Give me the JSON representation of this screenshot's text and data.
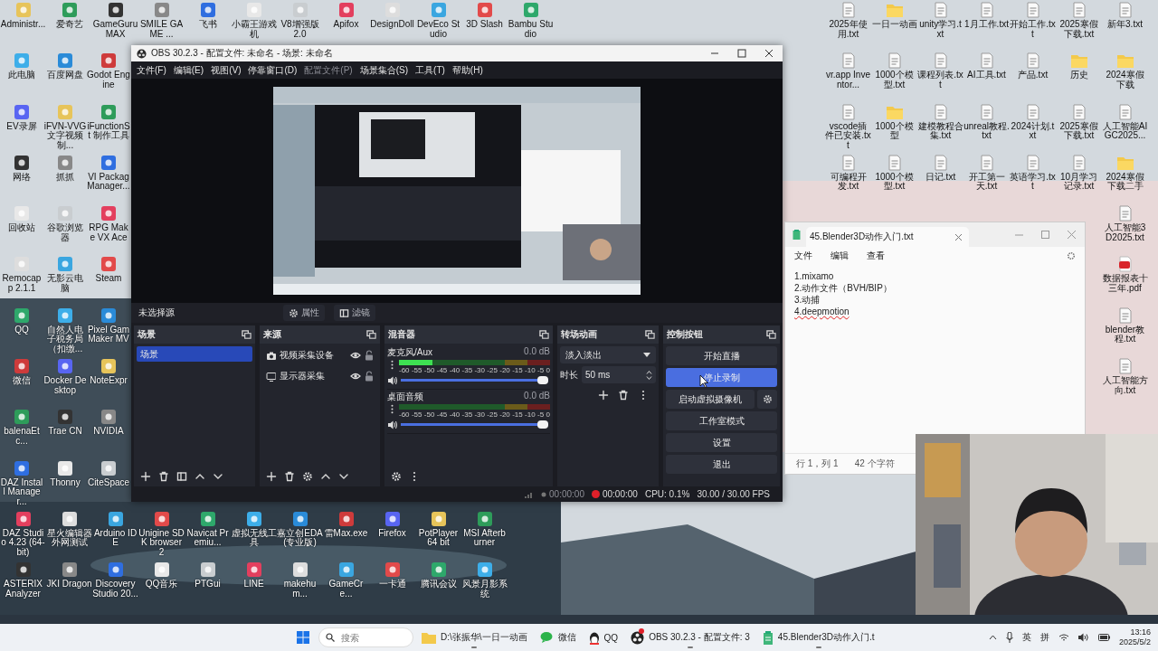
{
  "desktop": {
    "left_rows": [
      [
        {
          "label": "Administr..."
        },
        {
          "label": "爱奇艺"
        },
        {
          "label": "GameGuru MAX"
        },
        {
          "label": "SMILE GAME ..."
        },
        {
          "label": "飞书"
        },
        {
          "label": "小霸王游戏机"
        },
        {
          "label": "V8增强版 2.0"
        },
        {
          "label": "Apifox"
        },
        {
          "label": "DesignDoll"
        },
        {
          "label": "DevEco Studio"
        },
        {
          "label": "3D Slash"
        },
        {
          "label": "Bambu Studio"
        }
      ],
      [
        {
          "label": "此电脑"
        },
        {
          "label": "百度网盘"
        },
        {
          "label": "Godot Engine"
        }
      ],
      [
        {
          "label": "EV录屏"
        },
        {
          "label": "iFVN-VVG文字视频制..."
        },
        {
          "label": "iFunctionSt 制作工具"
        }
      ],
      [
        {
          "label": "网络"
        },
        {
          "label": "抓抓"
        },
        {
          "label": "VI Packag Manager..."
        }
      ],
      [
        {
          "label": "回收站"
        },
        {
          "label": "谷歌浏览器"
        },
        {
          "label": "RPG Make VX Ace"
        }
      ],
      [
        {
          "label": "Remocapp 2.1.1"
        },
        {
          "label": "无影云电脑"
        },
        {
          "label": "Steam"
        }
      ],
      [
        {
          "label": "QQ"
        },
        {
          "label": "自然人电子税务局（扣缴..."
        },
        {
          "label": "Pixel Gam Maker MV"
        }
      ],
      [
        {
          "label": "微信"
        },
        {
          "label": "Docker Desktop"
        },
        {
          "label": "NoteExpr"
        }
      ],
      [
        {
          "label": "balenaEtc..."
        },
        {
          "label": "Trae CN"
        },
        {
          "label": "NVIDIA"
        }
      ],
      [
        {
          "label": "DAZ Install Manager..."
        },
        {
          "label": "Thonny"
        },
        {
          "label": "CiteSpace"
        }
      ],
      [
        {
          "label": "DAZ Studio 4.23 (64-bit)"
        },
        {
          "label": "星火编辑器外网测试"
        },
        {
          "label": "Arduino IDE"
        },
        {
          "label": "Unigine SDK browser 2"
        },
        {
          "label": "Navicat Premiu..."
        },
        {
          "label": "虚拟无线工具"
        },
        {
          "label": "嘉立创EDA(专业版)"
        },
        {
          "label": "雷Max.exe"
        },
        {
          "label": "Firefox"
        },
        {
          "label": "PotPlayer 64 bit"
        },
        {
          "label": "MSI Afterburner"
        }
      ],
      [
        {
          "label": "ASTERIX Analyzer"
        },
        {
          "label": "JKI Dragon"
        },
        {
          "label": "Discovery Studio 20..."
        },
        {
          "label": "QQ音乐"
        },
        {
          "label": "PTGui"
        },
        {
          "label": "LINE"
        },
        {
          "label": "makehum..."
        },
        {
          "label": "GameCre..."
        },
        {
          "label": "一卡通"
        },
        {
          "label": "腾讯会议"
        },
        {
          "label": "风景月影系统"
        }
      ]
    ],
    "right_rows": [
      [
        {
          "kind": "file",
          "label": "2025年使用.txt"
        },
        {
          "kind": "folder",
          "label": "一日一动画"
        },
        {
          "kind": "file",
          "label": "unity学习.txt"
        },
        {
          "kind": "file",
          "label": "1月工作.txt"
        },
        {
          "kind": "file",
          "label": "开始工作.txt"
        },
        {
          "kind": "file",
          "label": "2025寒假下载.txt"
        },
        {
          "kind": "file",
          "label": "新年3.txt"
        }
      ],
      [
        {
          "kind": "file",
          "label": "vr.app Inventor..."
        },
        {
          "kind": "file",
          "label": "1000个模型.txt"
        },
        {
          "kind": "file",
          "label": "课程列表.txt"
        },
        {
          "kind": "file",
          "label": "AI工具.txt"
        },
        {
          "kind": "file",
          "label": "产品.txt"
        },
        {
          "kind": "folder",
          "label": "历史"
        },
        {
          "kind": "folder",
          "label": "2024寒假下载"
        }
      ],
      [
        {
          "kind": "file",
          "label": "vscode插件已安装.txt"
        },
        {
          "kind": "folder",
          "label": "1000个模型"
        },
        {
          "kind": "file",
          "label": "建模教程合集.txt"
        },
        {
          "kind": "file",
          "label": "unreal教程.txt"
        },
        {
          "kind": "file",
          "label": "2024计划.txt"
        },
        {
          "kind": "file",
          "label": "2025寒假下载.txt"
        },
        {
          "kind": "file",
          "label": "人工智能AIGC2025..."
        }
      ],
      [
        {
          "kind": "file",
          "label": "可编程开发.txt"
        },
        {
          "kind": "file",
          "label": "1000个模型.txt"
        },
        {
          "kind": "file",
          "label": "日记.txt"
        },
        {
          "kind": "file",
          "label": "开工第一天.txt"
        },
        {
          "kind": "file",
          "label": "英语学习.txt"
        },
        {
          "kind": "file",
          "label": "10月学习记录.txt"
        },
        {
          "kind": "folder",
          "label": "2024寒假下载二手"
        }
      ],
      [
        {
          "kind": "file",
          "label": "人工智能3D2025.txt"
        }
      ],
      [
        {
          "kind": "pdf",
          "label": "数据报表十三年.pdf"
        }
      ],
      [
        {
          "kind": "file",
          "label": "blender教程.txt"
        }
      ],
      [
        {
          "kind": "file",
          "label": "人工智能方向.txt"
        }
      ]
    ]
  },
  "obs": {
    "title": "OBS 30.2.3 - 配置文件: 未命名 - 场景: 未命名",
    "menu": [
      {
        "label": "文件(F)",
        "disabled": false
      },
      {
        "label": "编辑(E)",
        "disabled": false
      },
      {
        "label": "视图(V)",
        "disabled": false
      },
      {
        "label": "停靠窗口(D)",
        "disabled": false
      },
      {
        "label": "配置文件(P)",
        "disabled": true
      },
      {
        "label": "场景集合(S)",
        "disabled": false
      },
      {
        "label": "工具(T)",
        "disabled": false
      },
      {
        "label": "帮助(H)",
        "disabled": false
      }
    ],
    "source_toolbar": {
      "label": "未选择源",
      "properties": "属性",
      "filters": "滤镜"
    },
    "scenes": {
      "title": "场景",
      "items": [
        {
          "label": "场景",
          "selected": true
        }
      ]
    },
    "sources": {
      "title": "来源",
      "items": [
        {
          "kind": "camera",
          "label": "视频采集设备",
          "visible": true,
          "locked": false
        },
        {
          "kind": "display",
          "label": "显示器采集",
          "visible": true,
          "locked": false
        }
      ]
    },
    "mixer": {
      "title": "混音器",
      "channels": [
        {
          "name": "麦克风/Aux",
          "reading": "0.0 dB",
          "meter": {
            "level": 0.22
          },
          "fader": {
            "level": 1
          },
          "scale": [
            "-60",
            "-55",
            "-50",
            "-45",
            "-40",
            "-35",
            "-30",
            "-25",
            "-20",
            "-15",
            "-10",
            "-5",
            "0"
          ]
        },
        {
          "name": "桌面音频",
          "reading": "0.0 dB",
          "fader": {
            "level": 1
          },
          "scale": [
            "-60",
            "-55",
            "-50",
            "-45",
            "-40",
            "-35",
            "-30",
            "-25",
            "-20",
            "-15",
            "-10",
            "-5",
            "0"
          ]
        }
      ]
    },
    "transitions": {
      "title": "转场动画",
      "transition": "淡入淡出",
      "duration_label": "时长",
      "duration": "50 ms"
    },
    "controls": {
      "title": "控制按钮",
      "buttons": [
        {
          "kind": "plain",
          "label": "开始直播",
          "highlighted": false
        },
        {
          "kind": "plain",
          "label": "停止录制",
          "highlighted": true
        },
        {
          "kind": "with_settings",
          "label": "启动虚拟摄像机",
          "highlighted": false
        },
        {
          "kind": "plain",
          "label": "工作室模式",
          "highlighted": false
        },
        {
          "kind": "plain",
          "label": "设置",
          "highlighted": false
        },
        {
          "kind": "plain",
          "label": "退出",
          "highlighted": false
        }
      ]
    },
    "status": {
      "stream_time": "00:00:00",
      "record_time": "00:00:00",
      "cpu": "CPU: 0.1%",
      "fps": "30.00 / 30.00 FPS"
    }
  },
  "notepad": {
    "tab_title": "45.Blender3D动作入门.txt",
    "menu": [
      "文件",
      "编辑",
      "查看"
    ],
    "lines": [
      {
        "text": "1.mixamo",
        "misspelled": false
      },
      {
        "text": "2.动作文件（BVH/BIP）",
        "misspelled": false
      },
      {
        "text": "3.动捕",
        "misspelled": false
      },
      {
        "text": "4.deepmotion",
        "misspelled": true
      }
    ],
    "status": [
      "行 1，列 1",
      "42 个字符"
    ]
  },
  "taskbar": {
    "search_placeholder": "搜索",
    "apps": [
      {
        "kind": "folder",
        "label": "D:\\张振华\\一日一动画",
        "running": true,
        "recording": false
      },
      {
        "kind": "wechat",
        "label": "微信",
        "running": false,
        "recording": false
      },
      {
        "kind": "qq",
        "label": "QQ",
        "running": false,
        "recording": false
      },
      {
        "kind": "obs",
        "label": "OBS 30.2.3 - 配置文件: 3",
        "running": true,
        "recording": true
      },
      {
        "kind": "notepad",
        "label": "45.Blender3D动作入门.t",
        "running": true,
        "recording": false
      }
    ],
    "ime": [
      "英",
      "拼"
    ],
    "time": "13:16",
    "date": "2025/5/2"
  }
}
